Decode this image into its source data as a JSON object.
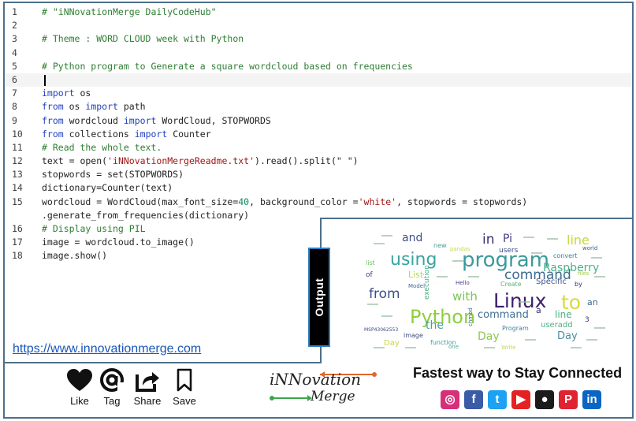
{
  "code": {
    "lines": [
      {
        "num": "1",
        "segments": [
          {
            "t": "comment",
            "text": "# \"iNNovationMerge DailyCodeHub\""
          }
        ]
      },
      {
        "num": "2",
        "segments": []
      },
      {
        "num": "3",
        "segments": [
          {
            "t": "comment",
            "text": "# Theme : WORD CLOUD week with Python"
          }
        ]
      },
      {
        "num": "4",
        "segments": []
      },
      {
        "num": "5",
        "segments": [
          {
            "t": "comment",
            "text": "# Python program to Generate a square wordcloud based on frequencies"
          }
        ]
      },
      {
        "num": "6",
        "segments": [],
        "active": true
      },
      {
        "num": "7",
        "segments": [
          {
            "t": "kw",
            "text": "import"
          },
          {
            "t": "plain",
            "text": " os"
          }
        ]
      },
      {
        "num": "8",
        "segments": [
          {
            "t": "kw",
            "text": "from"
          },
          {
            "t": "plain",
            "text": " os "
          },
          {
            "t": "kw",
            "text": "import"
          },
          {
            "t": "plain",
            "text": " path"
          }
        ]
      },
      {
        "num": "9",
        "segments": [
          {
            "t": "kw",
            "text": "from"
          },
          {
            "t": "plain",
            "text": " wordcloud "
          },
          {
            "t": "kw",
            "text": "import"
          },
          {
            "t": "plain",
            "text": " WordCloud, STOPWORDS"
          }
        ]
      },
      {
        "num": "10",
        "segments": [
          {
            "t": "kw",
            "text": "from"
          },
          {
            "t": "plain",
            "text": " collections "
          },
          {
            "t": "kw",
            "text": "import"
          },
          {
            "t": "plain",
            "text": " Counter"
          }
        ]
      },
      {
        "num": "11",
        "segments": [
          {
            "t": "comment",
            "text": "# Read the whole text."
          }
        ]
      },
      {
        "num": "12",
        "segments": [
          {
            "t": "plain",
            "text": "text = open("
          },
          {
            "t": "str",
            "text": "'iNNovationMergeReadme.txt'"
          },
          {
            "t": "plain",
            "text": ").read().split(\" \")"
          }
        ]
      },
      {
        "num": "13",
        "segments": [
          {
            "t": "plain",
            "text": "stopwords = set(STOPWORDS)"
          }
        ]
      },
      {
        "num": "14",
        "segments": [
          {
            "t": "plain",
            "text": "dictionary=Counter(text)"
          }
        ]
      },
      {
        "num": "15",
        "segments": [
          {
            "t": "plain",
            "text": "wordcloud = WordCloud(max_font_size="
          },
          {
            "t": "num",
            "text": "40"
          },
          {
            "t": "plain",
            "text": ", background_color ="
          },
          {
            "t": "str",
            "text": "'white'"
          },
          {
            "t": "plain",
            "text": ", stopwords = stopwords)"
          }
        ]
      },
      {
        "num": "",
        "segments": [
          {
            "t": "plain",
            "text": ".generate_from_frequencies(dictionary)"
          }
        ]
      },
      {
        "num": "16",
        "segments": [
          {
            "t": "comment",
            "text": "# Display using PIL"
          }
        ]
      },
      {
        "num": "17",
        "segments": [
          {
            "t": "plain",
            "text": "image = wordcloud.to_image()"
          }
        ]
      },
      {
        "num": "18",
        "segments": [
          {
            "t": "plain",
            "text": "image.show()"
          }
        ]
      }
    ]
  },
  "site_link": "https://www.innovationmerge.com",
  "output_label": "Output",
  "wordcloud": {
    "words": [
      {
        "text": "Python",
        "color": "#8fce3f"
      },
      {
        "text": "program",
        "color": "#3b9a9b"
      },
      {
        "text": "Linux",
        "color": "#3c1f6b"
      },
      {
        "text": "using",
        "color": "#3aa3a3"
      },
      {
        "text": "to",
        "color": "#d8dc3b"
      },
      {
        "text": "from",
        "color": "#3a4d87"
      },
      {
        "text": "command",
        "color": "#3b6a8f"
      },
      {
        "text": "Raspberry",
        "color": "#4cb08a"
      },
      {
        "text": "with",
        "color": "#7bc456"
      },
      {
        "text": "line",
        "color": "#c7d939"
      },
      {
        "text": "and",
        "color": "#3b4e86"
      },
      {
        "text": "in",
        "color": "#3d2a6e"
      },
      {
        "text": "Pi",
        "color": "#4e3b86"
      },
      {
        "text": "the",
        "color": "#48a0a0"
      },
      {
        "text": "List",
        "color": "#b7d94a"
      },
      {
        "text": "Day",
        "color": "#c9d744"
      },
      {
        "text": "Day",
        "color": "#8bc94b"
      },
      {
        "text": "Day",
        "color": "#4a8ea0"
      },
      {
        "text": "command",
        "color": "#3d6f97"
      },
      {
        "text": "line",
        "color": "#4bb081"
      },
      {
        "text": "users",
        "color": "#3b4f8c"
      },
      {
        "text": "an",
        "color": "#3b6d8d"
      },
      {
        "text": "Specific",
        "color": "#41558b"
      },
      {
        "text": "image",
        "color": "#3a4a82"
      },
      {
        "text": "Program",
        "color": "#46849a"
      },
      {
        "text": "function",
        "color": "#3f9a96"
      },
      {
        "text": "useradd",
        "color": "#4db080"
      },
      {
        "text": "Model",
        "color": "#3e6a8e"
      },
      {
        "text": "Hello",
        "color": "#4f3b84"
      },
      {
        "text": "new",
        "color": "#4e9d94"
      },
      {
        "text": "convert",
        "color": "#3d7c97"
      },
      {
        "text": "list",
        "color": "#6bc15e"
      },
      {
        "text": "of",
        "color": "#3a4784"
      },
      {
        "text": "by",
        "color": "#3c2e6e"
      },
      {
        "text": "Create",
        "color": "#55b47a"
      },
      {
        "text": "world",
        "color": "#3e5c8e"
      },
      {
        "text": "files",
        "color": "#9ccf46"
      },
      {
        "text": "pandas",
        "color": "#c8d941"
      },
      {
        "text": "one",
        "color": "#47a896"
      },
      {
        "text": "chmod",
        "color": "#3d6691"
      },
      {
        "text": "execution",
        "color": "#4ab085"
      },
      {
        "text": "a",
        "color": "#3c2e6e"
      },
      {
        "text": "3",
        "color": "#3c2e6e"
      },
      {
        "text": "Write",
        "color": "#c4d84a"
      },
      {
        "text": "MSP43062553",
        "color": "#3a4a82"
      }
    ]
  },
  "actions": [
    {
      "label": "Like",
      "icon": "heart-icon"
    },
    {
      "label": "Tag",
      "icon": "at-icon"
    },
    {
      "label": "Share",
      "icon": "share-icon"
    },
    {
      "label": "Save",
      "icon": "bookmark-icon"
    }
  ],
  "brand": {
    "top": "iNNovation",
    "bottom": "Merge",
    "arrow_color": "#e0672a",
    "arrow_color_2": "#3aa84a"
  },
  "tagline": "Fastest way to Stay Connected",
  "social": [
    {
      "name": "instagram-icon",
      "glyph": "◎",
      "color": "#d6307a"
    },
    {
      "name": "facebook-icon",
      "glyph": "f",
      "color": "#3b5ba7"
    },
    {
      "name": "twitter-icon",
      "glyph": "t",
      "color": "#1da1f2"
    },
    {
      "name": "youtube-icon",
      "glyph": "▶",
      "color": "#e52222"
    },
    {
      "name": "github-icon",
      "glyph": "●",
      "color": "#1b1b1b"
    },
    {
      "name": "pinterest-icon",
      "glyph": "P",
      "color": "#e02330"
    },
    {
      "name": "linkedin-icon",
      "glyph": "in",
      "color": "#0a66c2"
    }
  ]
}
